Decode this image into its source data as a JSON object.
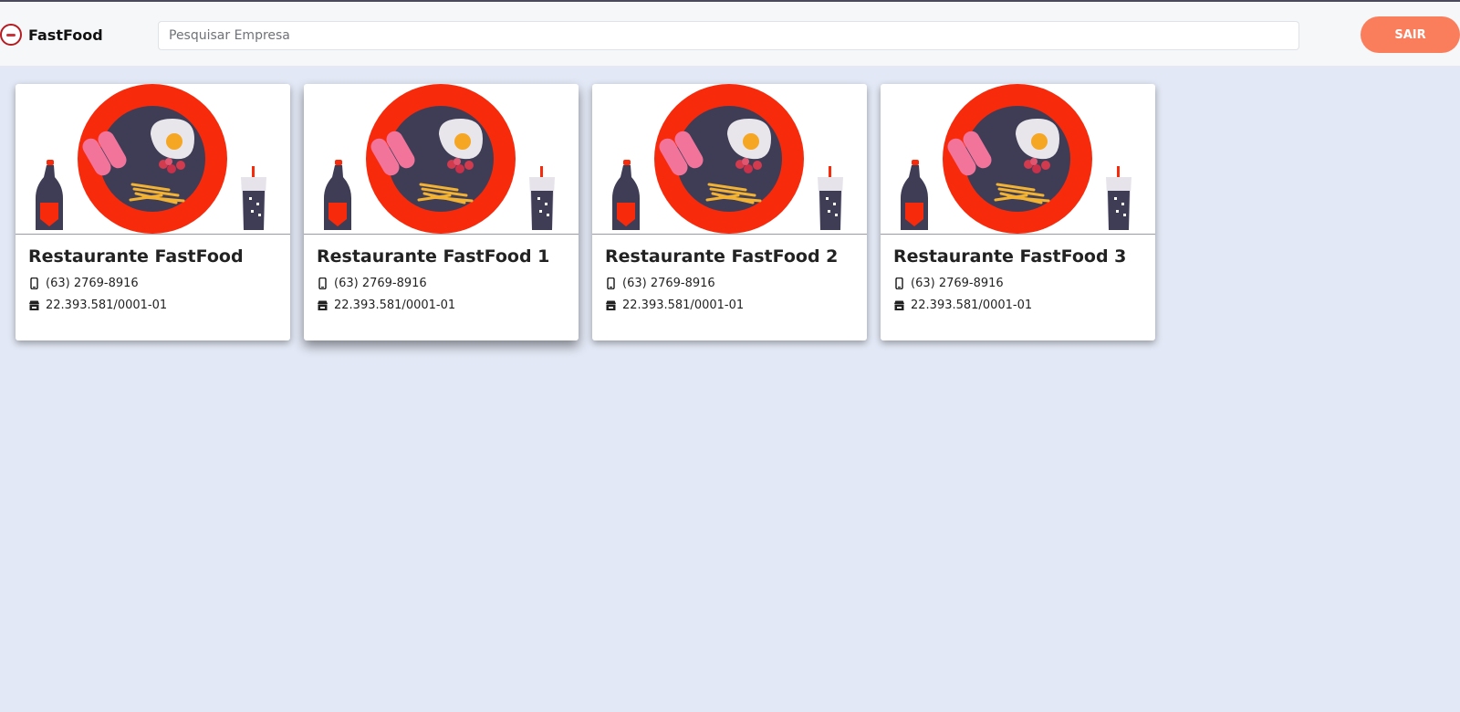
{
  "header": {
    "brand": "FastFood",
    "search_placeholder": "Pesquisar Empresa",
    "logout_label": "SAIR"
  },
  "colors": {
    "background": "#e2e8f5",
    "accent": "#fb7e5c",
    "plate_red": "#f72a0c",
    "plate_navy": "#3f3d56"
  },
  "icons": {
    "logo": "fastfood-logo-icon",
    "phone": "mobile-phone-icon",
    "company": "store-icon"
  },
  "restaurants": [
    {
      "name": "Restaurante FastFood",
      "phone": "(63) 2769-8916",
      "cnpj": "22.393.581/0001-01"
    },
    {
      "name": "Restaurante FastFood 1",
      "phone": "(63) 2769-8916",
      "cnpj": "22.393.581/0001-01"
    },
    {
      "name": "Restaurante FastFood 2",
      "phone": "(63) 2769-8916",
      "cnpj": "22.393.581/0001-01"
    },
    {
      "name": "Restaurante FastFood 3",
      "phone": "(63) 2769-8916",
      "cnpj": "22.393.581/0001-01"
    }
  ]
}
